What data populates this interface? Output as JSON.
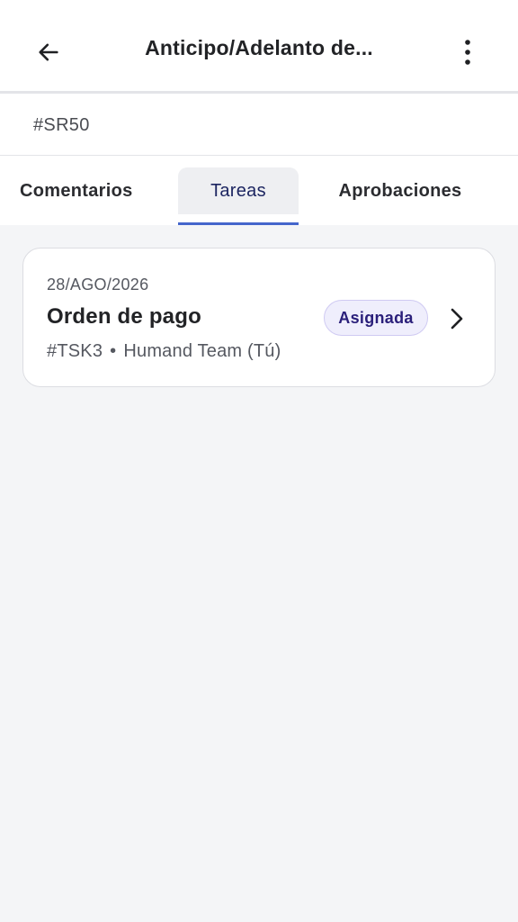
{
  "header": {
    "title": "Anticipo/Adelanto de...",
    "back_icon": "arrow-left-icon",
    "more_icon": "more-vertical-icon"
  },
  "request": {
    "code": "#SR50"
  },
  "tabs": [
    {
      "label": "Comentarios",
      "selected": false
    },
    {
      "label": "Tareas",
      "selected": true
    },
    {
      "label": "Aprobaciones",
      "selected": false
    }
  ],
  "tasks": [
    {
      "date": "28/AGO/2026",
      "title": "Orden de pago",
      "code": "#TSK3",
      "separator": "•",
      "assignee": "Humand Team (Tú)",
      "status": "Asignada",
      "chevron_icon": "chevron-right-icon"
    }
  ],
  "colors": {
    "accent": "#4466cc",
    "badge_bg": "#efeefc",
    "badge_text": "#2a1f7a",
    "background": "#f4f5f7"
  }
}
